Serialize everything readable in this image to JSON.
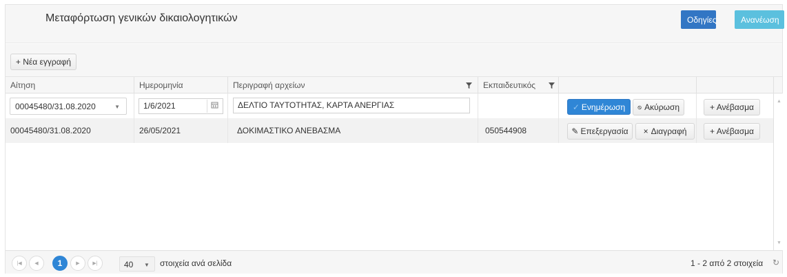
{
  "header": {
    "title": "Μεταφόρτωση γενικών δικαιολογητικών",
    "help_label": "Οδηγίες",
    "refresh_label": "Ανανέωση"
  },
  "toolbar": {
    "new_record_label": "+ Νέα εγγραφή"
  },
  "columns": [
    "Αίτηση",
    "Ημερομηνία",
    "Περιγραφή αρχείων",
    "Εκπαιδευτικός"
  ],
  "edit_row": {
    "application": "00045480/31.08.2020",
    "date": "1/6/2021",
    "description": "ΔΕΛΤΙΟ ΤΑΥΤΟΤΗΤΑΣ, ΚΑΡΤΑ ΑΝΕΡΓΙΑΣ",
    "teacher": "",
    "update_label": "Ενημέρωση",
    "cancel_label": "Ακύρωση",
    "upload_label": "+ Ανέβασμα"
  },
  "rows": [
    {
      "application": "00045480/31.08.2020",
      "date": "26/05/2021",
      "description": "ΔΟΚΙΜΑΣΤΙΚΟ ΑΝΕΒΑΣΜΑ",
      "teacher": "050544908",
      "edit_label": "Επεξεργασία",
      "delete_label": "Διαγραφή",
      "upload_label": "+ Ανέβασμα"
    }
  ],
  "pager": {
    "current_page": "1",
    "page_size": "40",
    "page_size_label": "στοιχεία ανά σελίδα",
    "info": "1 - 2 από 2 στοιχεία"
  },
  "colors": {
    "primary": "#2f86d6",
    "info": "#5bc0de",
    "header_bg": "#f6f6f6"
  }
}
